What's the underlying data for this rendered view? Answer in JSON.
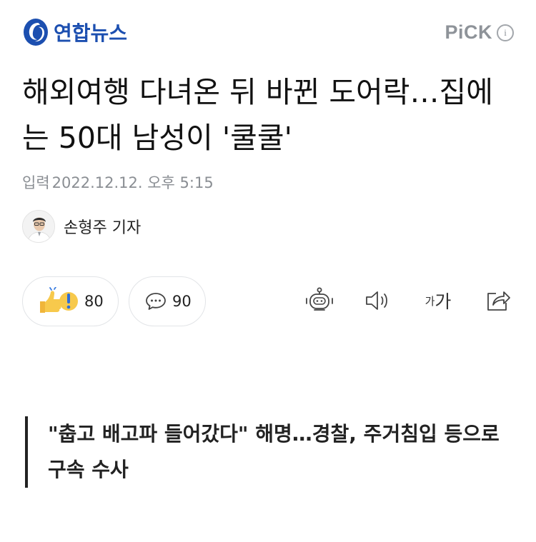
{
  "header": {
    "brand_name": "연합뉴스",
    "pick_label": "PiCK",
    "info_icon": "info-icon"
  },
  "article": {
    "title": "해외여행 다녀온 뒤 바뀐 도어락…집에는 50대 남성이 '쿨쿨'",
    "date_label": "입력",
    "date_value": "2022.12.12. 오후 5:15",
    "reporter": "손형주 기자",
    "subheading": "\"춥고 배고파 들어갔다\" 해명…경찰, 주거침입 등으로 구속 수사"
  },
  "reactions": {
    "like_count": "80",
    "comment_count": "90"
  },
  "toolbar": {
    "font_small": "가",
    "font_big": "가",
    "icons": [
      "summary-bot-icon",
      "speaker-icon",
      "font-size-icon",
      "share-icon"
    ]
  },
  "colors": {
    "brand_blue": "#1c4fb0",
    "muted_gray": "#8a8e93",
    "pill_border": "#e2e4e7",
    "thumb_yellow": "#f5c242"
  }
}
